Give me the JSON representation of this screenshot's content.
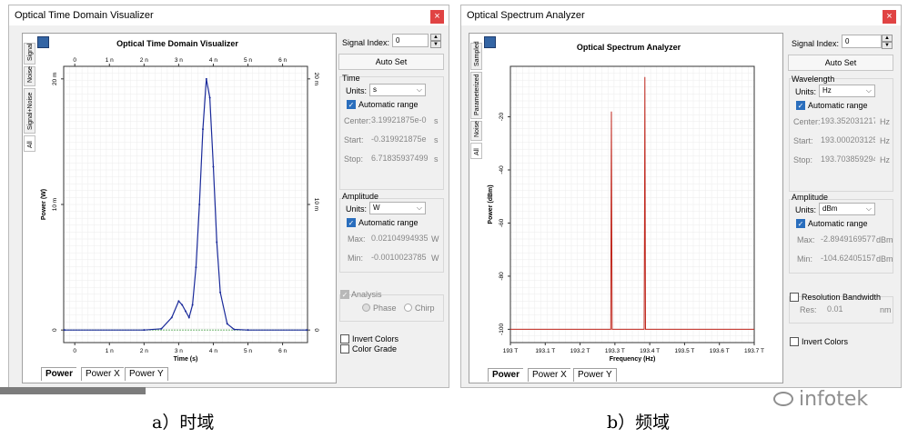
{
  "left_window": {
    "title": "Optical Time Domain Visualizer",
    "close_label": "×",
    "plot_title": "Optical Time Domain Visualizer",
    "side_tabs": [
      "Signal",
      "Noise",
      "Signal+Noise",
      "All"
    ],
    "bottom_tabs": [
      "Power",
      "Power X",
      "Power Y"
    ],
    "signal_index_label": "Signal Index:",
    "signal_index_value": "0",
    "autoset_label": "Auto Set",
    "time_group": "Time",
    "time_units_label": "Units:",
    "time_units_value": "s",
    "time_auto_label": "Automatic range",
    "center_label": "Center:",
    "center_value": "3.19921875e-0",
    "center_unit": "s",
    "start_label": "Start:",
    "start_value": "-0.319921875e",
    "start_unit": "s",
    "stop_label": "Stop:",
    "stop_value": "6.71835937499",
    "stop_unit": "s",
    "amp_group": "Amplitude",
    "amp_units_label": "Units:",
    "amp_units_value": "W",
    "amp_auto_label": "Automatic range",
    "max_label": "Max:",
    "max_value": "0.021049949358",
    "max_unit": "W",
    "min_label": "Min:",
    "min_value": "-0.0010023785",
    "min_unit": "W",
    "analysis_label": "Analysis",
    "phase_label": "Phase",
    "chirp_label": "Chirp",
    "invert_label": "Invert Colors",
    "grade_label": "Color Grade"
  },
  "right_window": {
    "title": "Optical Spectrum Analyzer",
    "close_label": "×",
    "plot_title": "Optical Spectrum Analyzer",
    "side_tabs": [
      "Sampled",
      "Parameterized",
      "Noise",
      "All"
    ],
    "bottom_tabs": [
      "Power",
      "Power X",
      "Power Y"
    ],
    "signal_index_label": "Signal Index:",
    "signal_index_value": "0",
    "autoset_label": "Auto Set",
    "wl_group": "Wavelength",
    "wl_units_label": "Units:",
    "wl_units_value": "Hz",
    "wl_auto_label": "Automatic range",
    "center_label": "Center:",
    "center_value": "193.352031217",
    "center_unit": "Hz",
    "start_label": "Start:",
    "start_value": "193.000203125",
    "start_unit": "Hz",
    "stop_label": "Stop:",
    "stop_value": "193.703859294",
    "stop_unit": "Hz",
    "amp_group": "Amplitude",
    "amp_units_label": "Units:",
    "amp_units_value": "dBm",
    "amp_auto_label": "Automatic range",
    "max_label": "Max:",
    "max_value": "-2.8949169577",
    "max_unit": "dBm",
    "min_label": "Min:",
    "min_value": "-104.62405157",
    "min_unit": "dBm",
    "res_bw_label": "Resolution Bandwidth",
    "res_label": "Res:",
    "res_value": "0.01",
    "res_unit": "nm",
    "invert_label": "Invert Colors"
  },
  "captions": {
    "left": "a）时域",
    "right": "b）频域"
  },
  "watermark": "infotek",
  "colors": {
    "time_trace": "#1a2a9a",
    "spectrum_trace": "#c0281e",
    "baseline_dots": "#3a9a3a",
    "check_blue": "#2a6ebd",
    "close_red": "#e04343"
  },
  "chart_data": [
    {
      "type": "line",
      "title": "Optical Time Domain Visualizer",
      "xlabel": "Time (s)",
      "ylabel": "Power (W)",
      "x_ticks": [
        "0",
        "1 n",
        "2 n",
        "3 n",
        "4 n",
        "5 n",
        "6 n"
      ],
      "y_ticks": [
        "0",
        "10 m",
        "20 m"
      ],
      "xlim": [
        -0.32,
        6.72
      ],
      "ylim": [
        -1,
        21
      ],
      "x_unit": "ns",
      "y_unit": "mW",
      "series": [
        {
          "x": [
            -0.3,
            2.0,
            2.5,
            2.8,
            3.0,
            3.1,
            3.2,
            3.3,
            3.4,
            3.5,
            3.6,
            3.7,
            3.8,
            3.9,
            4.0,
            4.1,
            4.2,
            4.4,
            4.6,
            5.0,
            6.7
          ],
          "y": [
            0,
            0,
            0.1,
            1.0,
            2.3,
            2.0,
            1.5,
            1.0,
            2.0,
            5.0,
            10.0,
            16.0,
            20.0,
            18.5,
            13.0,
            7.0,
            3.0,
            0.5,
            0.05,
            0,
            0
          ]
        }
      ]
    },
    {
      "type": "line",
      "title": "Optical Spectrum Analyzer",
      "xlabel": "Frequency (Hz)",
      "ylabel": "Power (dBm)",
      "x_ticks": [
        "193 T",
        "193.1 T",
        "193.2 T",
        "193.3 T",
        "193.4 T",
        "193.5 T",
        "193.6 T",
        "193.7 T"
      ],
      "y_ticks": [
        "-20",
        "-40",
        "-60",
        "-80",
        "-100"
      ],
      "xlim": [
        193.0,
        193.7
      ],
      "ylim": [
        -105,
        -1
      ],
      "x_unit": "THz",
      "y_unit": "dBm",
      "series": [
        {
          "x": [
            193.0,
            193.288,
            193.289,
            193.29,
            193.291,
            193.292,
            193.384,
            193.385,
            193.386,
            193.387,
            193.388,
            193.7
          ],
          "y": [
            -100,
            -100,
            -60,
            -18,
            -60,
            -100,
            -100,
            -60,
            -5,
            -60,
            -100,
            -100
          ]
        }
      ]
    }
  ]
}
